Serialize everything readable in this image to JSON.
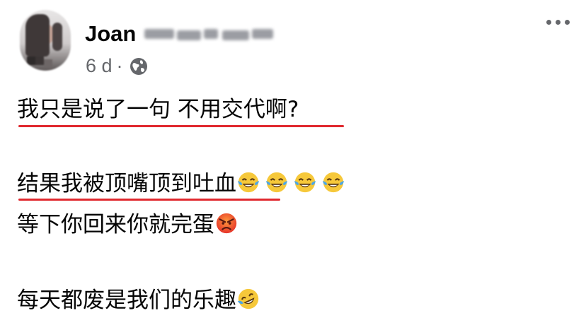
{
  "post": {
    "author_first_name": "Joan",
    "age": "6 d",
    "separator": "·",
    "audience_icon": "globe-icon",
    "menu_icon": "more-horizontal-icon"
  },
  "content": {
    "line1": "我只是说了一句 不用交代啊?",
    "line2": "结果我被顶嘴顶到吐血",
    "line2_emojis": [
      "face-with-tears-of-joy-emoji",
      "face-with-tears-of-joy-emoji",
      "face-with-tears-of-joy-emoji",
      "face-with-tears-of-joy-emoji"
    ],
    "line3": "等下你回来你就完蛋",
    "line3_emoji": "angry-face-emoji",
    "line4": "每天都废是我们的乐趣",
    "line4_emoji": "rolling-on-the-floor-laughing-emoji"
  },
  "colors": {
    "underline": "#e0282e",
    "meta_text": "#65676b",
    "text": "#050505"
  }
}
